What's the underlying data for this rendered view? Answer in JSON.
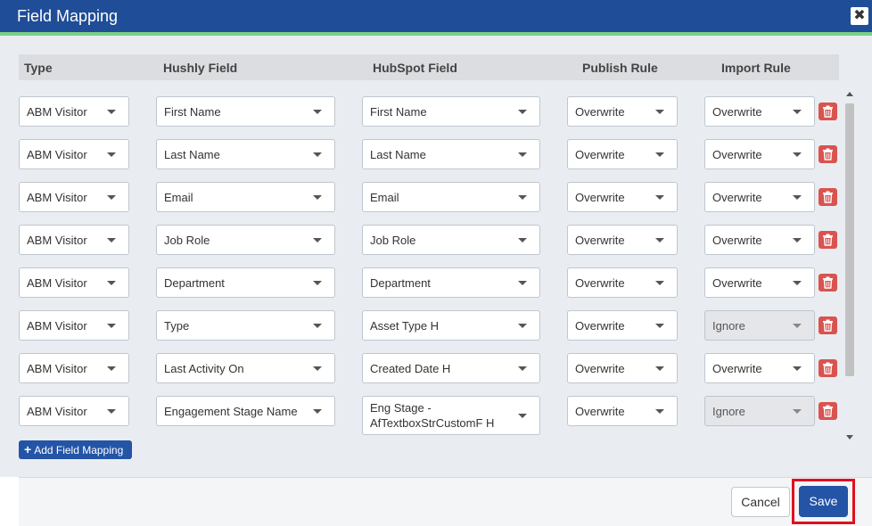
{
  "dialog": {
    "title": "Field Mapping",
    "close_label": "✖"
  },
  "table": {
    "headers": [
      "Type",
      "Hushly Field",
      "HubSpot Field",
      "Publish Rule",
      "Import Rule"
    ],
    "rows": [
      {
        "type": "ABM Visitor",
        "hushly": "First Name",
        "hubspot": "First Name",
        "publish": "Overwrite",
        "import": "Overwrite",
        "import_disabled": false
      },
      {
        "type": "ABM Visitor",
        "hushly": "Last Name",
        "hubspot": "Last Name",
        "publish": "Overwrite",
        "import": "Overwrite",
        "import_disabled": false
      },
      {
        "type": "ABM Visitor",
        "hushly": "Email",
        "hubspot": "Email",
        "publish": "Overwrite",
        "import": "Overwrite",
        "import_disabled": false
      },
      {
        "type": "ABM Visitor",
        "hushly": "Job Role",
        "hubspot": "Job Role",
        "publish": "Overwrite",
        "import": "Overwrite",
        "import_disabled": false
      },
      {
        "type": "ABM Visitor",
        "hushly": "Department",
        "hubspot": "Department",
        "publish": "Overwrite",
        "import": "Overwrite",
        "import_disabled": false
      },
      {
        "type": "ABM Visitor",
        "hushly": "Type",
        "hubspot": "Asset Type H",
        "publish": "Overwrite",
        "import": "Ignore",
        "import_disabled": true
      },
      {
        "type": "ABM Visitor",
        "hushly": "Last Activity On",
        "hubspot": "Created Date H",
        "publish": "Overwrite",
        "import": "Overwrite",
        "import_disabled": false
      },
      {
        "type": "ABM Visitor",
        "hushly": "Engagement Stage Name",
        "hubspot": "Eng Stage - AfTextboxStrCustomF H",
        "publish": "Overwrite",
        "import": "Ignore",
        "import_disabled": true
      },
      {
        "type": "",
        "hushly": "",
        "hubspot": "",
        "publish": "",
        "import": "",
        "import_disabled": true
      }
    ]
  },
  "actions": {
    "add_mapping_label": "Add Field Mapping",
    "cancel_label": "Cancel",
    "save_label": "Save"
  },
  "colors": {
    "title_bar": "#1f4d97",
    "accent_bar": "#7ccf86",
    "delete_button": "#d9534f",
    "primary_button": "#2354a6",
    "highlight_box": "#e01020"
  }
}
